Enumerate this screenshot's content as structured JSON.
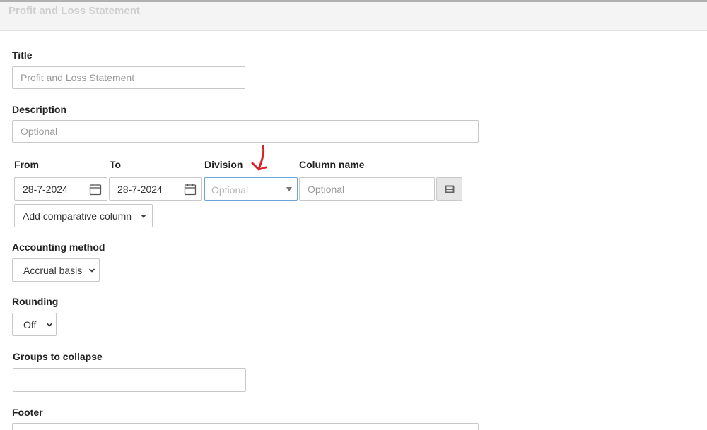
{
  "header": {
    "title": "Profit and Loss Statement"
  },
  "title_field": {
    "label": "Title",
    "placeholder": "Profit and Loss Statement"
  },
  "description_field": {
    "label": "Description",
    "placeholder": "Optional"
  },
  "columns": {
    "from_label": "From",
    "to_label": "To",
    "division_label": "Division",
    "column_name_label": "Column name",
    "from_value": "28-7-2024",
    "to_value": "28-7-2024",
    "division_placeholder": "Optional",
    "column_name_placeholder": "Optional",
    "add_comparative_label": "Add comparative column"
  },
  "accounting_method": {
    "label": "Accounting method",
    "value": "Accrual basis"
  },
  "rounding": {
    "label": "Rounding",
    "value": "Off"
  },
  "groups_to_collapse": {
    "label": "Groups to collapse",
    "value": ""
  },
  "footer_field": {
    "label": "Footer"
  },
  "icons": [
    "calendar-icon",
    "dropdown-triangle-icon",
    "columns-icon",
    "chevron-down-icon"
  ],
  "colors": {
    "division_focus_border": "#6aa3d9",
    "annotation": "#d9232a"
  }
}
